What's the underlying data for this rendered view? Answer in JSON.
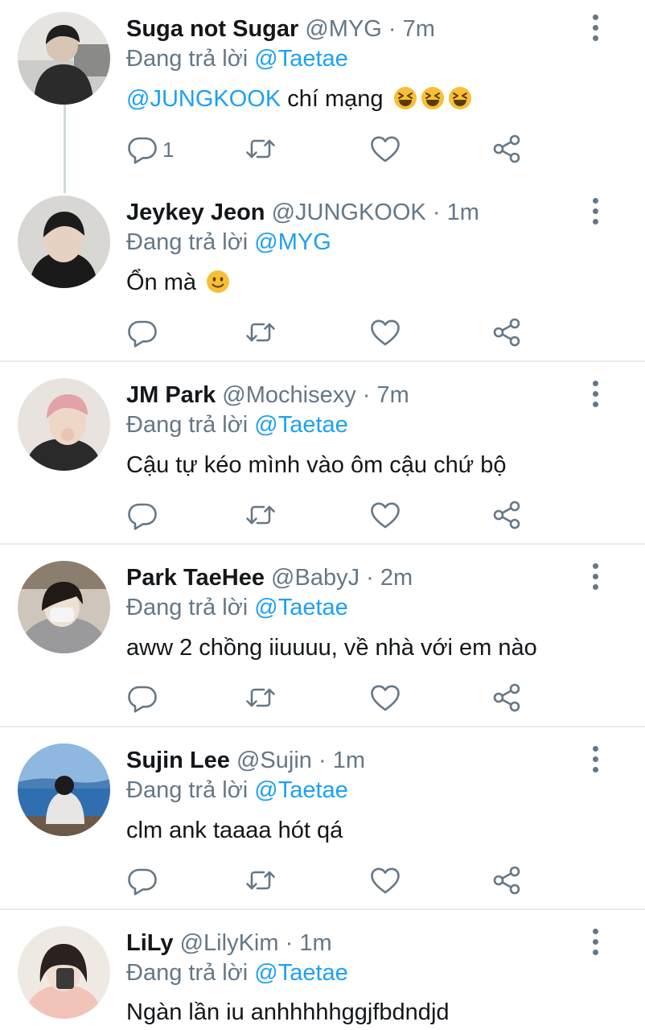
{
  "reply_prefix": "Đang trả lời",
  "dot": "·",
  "colors": {
    "name": "#14171a",
    "secondary": "#657786",
    "mention": "#1da1f2",
    "divider": "#e6ecf0"
  },
  "action_icons": [
    "reply-icon",
    "retweet-icon",
    "like-icon",
    "share-icon"
  ],
  "tweets": [
    {
      "name": "Suga not Sugar",
      "handle": "@MYG",
      "time": "7m",
      "replying_to": "@Taetae",
      "mention": "@JUNGKOOK",
      "text": "chí mạng",
      "emojis": [
        "laughing-emoji",
        "laughing-emoji",
        "laughing-emoji"
      ],
      "reply_count": "1"
    },
    {
      "name": "Jeykey Jeon",
      "handle": "@JUNGKOOK",
      "time": "1m",
      "replying_to": "@MYG",
      "text": "Ổn mà",
      "emojis": [
        "smile-emoji"
      ],
      "reply_count": ""
    },
    {
      "name": "JM Park",
      "handle": "@Mochisexy",
      "time": "7m",
      "replying_to": "@Taetae",
      "text": "Cậu tự kéo mình vào ôm cậu chứ bộ",
      "reply_count": ""
    },
    {
      "name": "Park TaeHee",
      "handle": "@BabyJ",
      "time": "2m",
      "replying_to": "@Taetae",
      "text": "aww 2 chồng iiuuuu, về nhà với em nào",
      "reply_count": ""
    },
    {
      "name": "Sujin Lee",
      "handle": "@Sujin",
      "time": "1m",
      "replying_to": "@Taetae",
      "text": "clm ank taaaa hót qá",
      "reply_count": ""
    },
    {
      "name": "LiLy",
      "handle": "@LilyKim",
      "time": "1m",
      "replying_to": "@Taetae",
      "text": "Ngàn lần iu anhhhhhggjfbdndjd",
      "reply_count": ""
    }
  ]
}
